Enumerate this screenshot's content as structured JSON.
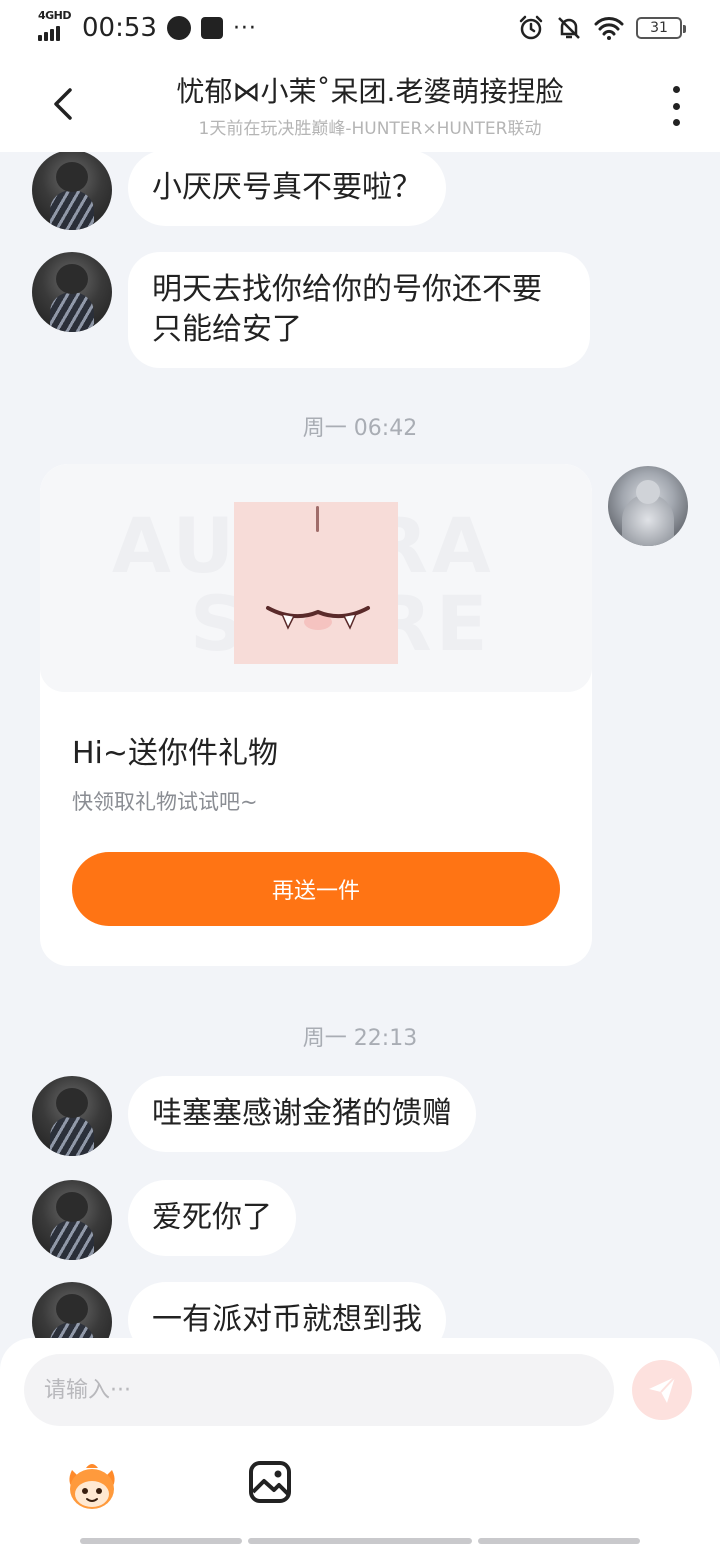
{
  "status_bar": {
    "network": "4GHD",
    "time": "00:53",
    "more": "···",
    "battery": "31"
  },
  "header": {
    "title": "忧郁⋈小茉˚呆团.老婆萌接捏脸",
    "subtitle": "1天前在玩决胜巅峰-HUNTER×HUNTER联动"
  },
  "messages_top": [
    {
      "text": "小厌厌号真不要啦？"
    },
    {
      "text": "明天去找你给你的号你还不要只能给安了"
    }
  ],
  "timestamp_1": "周一 06:42",
  "gift_card": {
    "watermark_1": "AURORA",
    "watermark_2": "STORE",
    "title": "Hi~送你件礼物",
    "description": "快领取礼物试试吧~",
    "button_label": "再送一件"
  },
  "timestamp_2": "周一 22:13",
  "messages_bottom": [
    {
      "text": "哇塞塞感谢金猪的馈赠"
    },
    {
      "text": "爱死你了"
    },
    {
      "text": "一有派对币就想到我"
    }
  ],
  "composer": {
    "placeholder": "请输入···"
  },
  "colors": {
    "accent": "#ff7414",
    "background": "#f2f4f8",
    "send_button": "#fde1de"
  },
  "icons": [
    "back-arrow-icon",
    "more-vertical-icon",
    "send-icon",
    "mascot-icon",
    "image-icon"
  ]
}
